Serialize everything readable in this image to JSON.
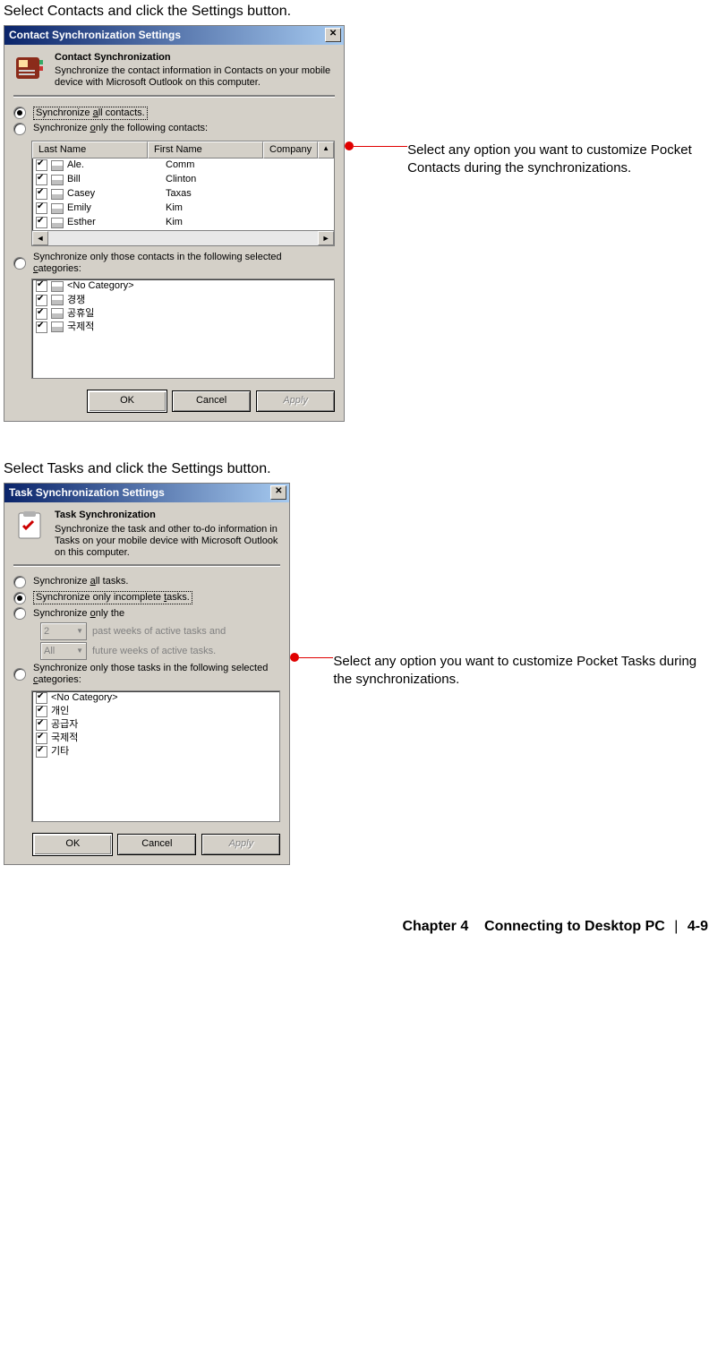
{
  "instructions": {
    "contacts": "Select Contacts and click the Settings button.",
    "tasks": "Select Tasks and click the Settings button."
  },
  "annotations": {
    "contacts": "Select any option you want to customize Pocket Contacts during the synchronizations.",
    "tasks": "Select any option you want to customize Pocket Tasks during the synchronizations."
  },
  "contactsDialog": {
    "title": "Contact Synchronization Settings",
    "headerTitle": "Contact Synchronization",
    "headerSub": "Synchronize the contact information in Contacts on your mobile device with Microsoft Outlook on this computer.",
    "opt1_pre": "Synchronize ",
    "opt1_u": "a",
    "opt1_post": "ll contacts.",
    "opt2_pre": "Synchronize ",
    "opt2_u": "o",
    "opt2_post": "nly the following contacts:",
    "columns": {
      "lastName": "Last Name",
      "firstName": "First Name",
      "company": "Company"
    },
    "rows": [
      {
        "last": "Ale.",
        "first": "Comm",
        "company": ""
      },
      {
        "last": "Bill",
        "first": "Clinton",
        "company": ""
      },
      {
        "last": "Casey",
        "first": "Taxas",
        "company": ""
      },
      {
        "last": "Emily",
        "first": "Kim",
        "company": ""
      },
      {
        "last": "Esther",
        "first": "Kim",
        "company": ""
      }
    ],
    "opt3_pre1": "Synchronize only those contacts in the following selected ",
    "opt3_u": "c",
    "opt3_post": "ategories:",
    "categories": [
      "<No Category>",
      "경쟁",
      "공휴일",
      "국제적"
    ],
    "buttons": {
      "ok": "OK",
      "cancel": "Cancel",
      "apply": "Apply"
    }
  },
  "tasksDialog": {
    "title": "Task Synchronization Settings",
    "headerTitle": "Task Synchronization",
    "headerSub": "Synchronize the task and other to-do information in Tasks on your mobile device with Microsoft Outlook on this computer.",
    "opt1_pre": "Synchronize ",
    "opt1_u": "a",
    "opt1_post": "ll tasks.",
    "opt2_pre": "Synchronize only incomplete ",
    "opt2_u": "t",
    "opt2_post": "asks.",
    "opt3_pre": "Synchronize ",
    "opt3_u": "o",
    "opt3_post": "nly the",
    "sub1_val": "2",
    "sub1_txt": "past weeks of active tasks and",
    "sub2_val": "All",
    "sub2_txt": "future weeks of active tasks.",
    "opt4_pre": "Synchronize only those tasks in the following selected ",
    "opt4_u": "c",
    "opt4_post": "ategories:",
    "categories": [
      "<No Category>",
      "개인",
      "공급자",
      "국제적",
      "기타"
    ],
    "buttons": {
      "ok": "OK",
      "cancel": "Cancel",
      "apply": "Apply"
    }
  },
  "footer": {
    "chapter": "Chapter 4",
    "title": "Connecting to Desktop PC",
    "page": "4-9"
  }
}
